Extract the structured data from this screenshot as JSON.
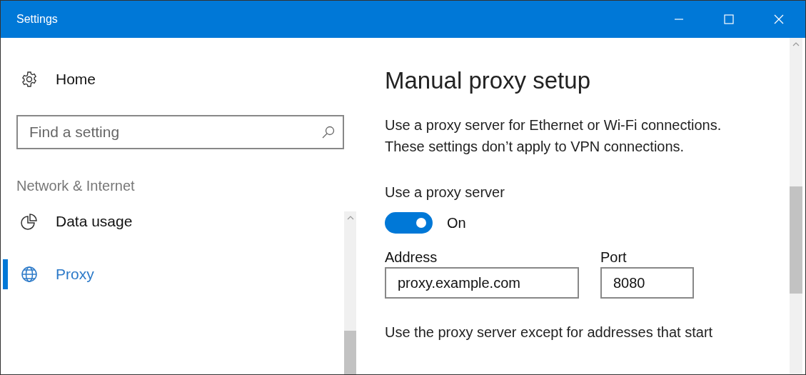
{
  "window": {
    "title": "Settings"
  },
  "sidebar": {
    "home": {
      "label": "Home"
    },
    "search": {
      "placeholder": "Find a setting"
    },
    "section": "Network & Internet",
    "items": [
      {
        "label": "Data usage",
        "selected": false
      },
      {
        "label": "Proxy",
        "selected": true
      }
    ]
  },
  "main": {
    "title": "Manual proxy setup",
    "description": [
      "Use a proxy server for Ethernet or Wi-Fi connections.",
      "These settings don’t apply to VPN connections."
    ],
    "toggle": {
      "label": "Use a proxy server",
      "on": true,
      "state_text": "On"
    },
    "address": {
      "label": "Address",
      "value": "proxy.example.com"
    },
    "port": {
      "label": "Port",
      "value": "8080"
    },
    "exceptions_text": "Use the proxy server except for addresses that start"
  }
}
